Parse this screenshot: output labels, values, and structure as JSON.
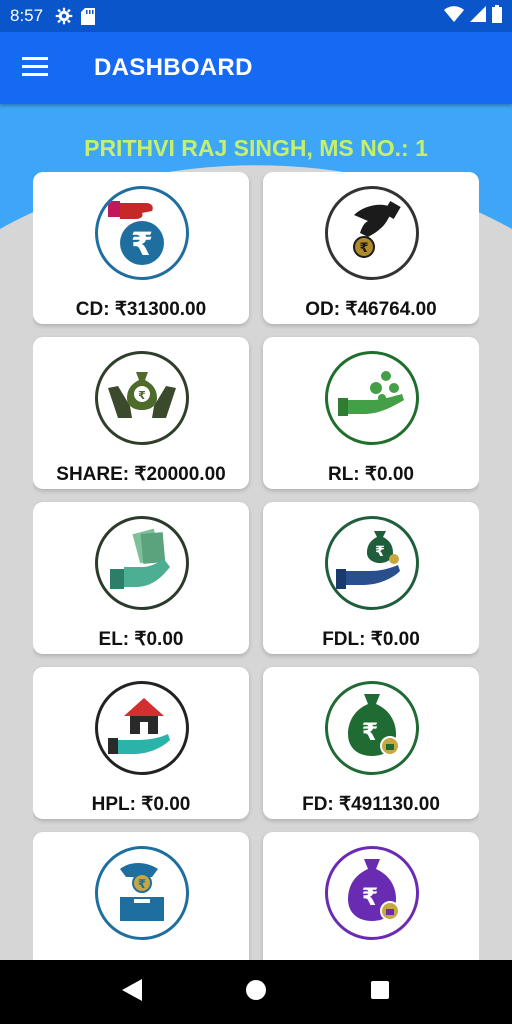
{
  "status_bar": {
    "time": "8:57",
    "left_icons": [
      "settings-icon",
      "sd-card-icon"
    ],
    "right_icons": [
      "wifi-icon",
      "signal-icon",
      "battery-icon"
    ]
  },
  "app_bar": {
    "title": "DASHBOARD",
    "menu_icon": "hamburger-menu-icon",
    "color": "#1569f2"
  },
  "welcome_text": "PRITHVI RAJ SINGH, MS NO.: 1",
  "colors": {
    "status_bar": "#0a55c9",
    "hero": "#3ea6f7",
    "welcome_text": "#c6f06a",
    "background": "#d6d6d6"
  },
  "cards": [
    {
      "label": "CD: ₹31300.00",
      "icon": "hand-giving-rupee-icon",
      "ring": "#1e6ea0"
    },
    {
      "label": "OD: ₹46764.00",
      "icon": "hand-holding-coin-icon",
      "ring": "#333333"
    },
    {
      "label": "SHARE: ₹20000.00",
      "icon": "hands-holding-money-bag-icon",
      "ring": "#2f3f2a"
    },
    {
      "label": "RL: ₹0.00",
      "icon": "hand-receiving-coins-icon",
      "ring": "#1f6e2c"
    },
    {
      "label": "EL: ₹0.00",
      "icon": "hand-with-cash-icon",
      "ring": "#2b3b2b"
    },
    {
      "label": "FDL: ₹0.00",
      "icon": "hand-with-locked-money-bag-icon",
      "ring": "#1f5e3a"
    },
    {
      "label": "HPL: ₹0.00",
      "icon": "hand-holding-house-icon",
      "ring": "#222222"
    },
    {
      "label": "FD: ₹491130.00",
      "icon": "locked-money-bag-green-icon",
      "ring": "#1f6b33"
    },
    {
      "label": "",
      "icon": "hand-depositing-coin-icon",
      "ring": "#1e6ea0"
    },
    {
      "label": "",
      "icon": "locked-money-bag-purple-icon",
      "ring": "#6a2bb3"
    }
  ],
  "nav_bar": {
    "back_icon": "back-triangle-icon",
    "home_icon": "home-circle-icon",
    "recents_icon": "recents-square-icon"
  }
}
